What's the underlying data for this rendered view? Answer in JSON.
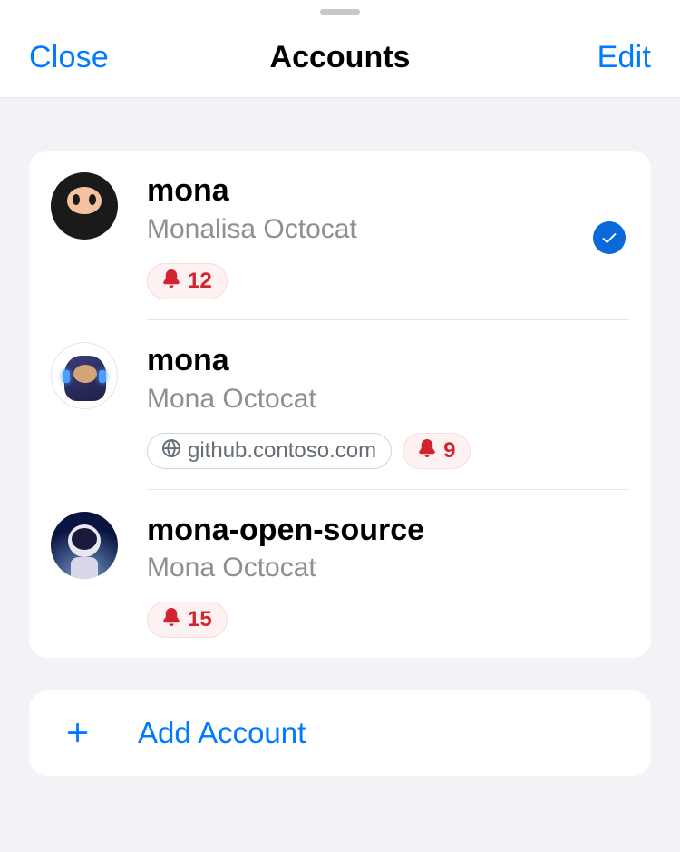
{
  "nav": {
    "close_label": "Close",
    "title": "Accounts",
    "edit_label": "Edit"
  },
  "accounts": [
    {
      "username": "mona",
      "fullname": "Monalisa Octocat",
      "notifications": "12",
      "active": true,
      "server": null
    },
    {
      "username": "mona",
      "fullname": "Mona Octocat",
      "notifications": "9",
      "active": false,
      "server": "github.contoso.com"
    },
    {
      "username": "mona-open-source",
      "fullname": "Mona Octocat",
      "notifications": "15",
      "active": false,
      "server": null
    }
  ],
  "add_account_label": "Add Account"
}
